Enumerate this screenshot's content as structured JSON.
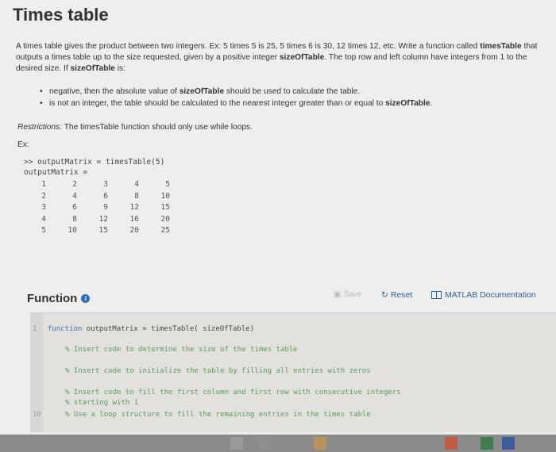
{
  "title": "Times table",
  "description": {
    "p1": "A times table gives the product between two integers. Ex: 5 times 5 is 25,  5 times 6 is 30, 12 times 12, etc. Write a function called ",
    "fname": "timesTable",
    "p2": " that outputs a times table up to the size requested, given by a positive integer ",
    "arg1": "sizeOfTable",
    "p3": ". The top row and left column have integers from 1 to the desired size. If ",
    "arg2": "sizeOfTable",
    "p4": " is:"
  },
  "bullets": [
    {
      "pre": "negative, then the absolute value of ",
      "bold": "sizeOfTable",
      "post": " should be used to calculate the table."
    },
    {
      "pre": "is not an integer, the table should be calculated to the nearest integer greater than or equal to ",
      "bold": "sizeOfTable",
      "post": "."
    }
  ],
  "restrictions": {
    "label": "Restrictions:",
    "text": " The timesTable function should only use while loops."
  },
  "example_label": "Ex:",
  "code_lines": [
    ">> outputMatrix = timesTable(5)",
    "outputMatrix ="
  ],
  "matrix": [
    [
      "1",
      "2",
      "3",
      "4",
      "5"
    ],
    [
      "2",
      "4",
      "6",
      "8",
      "10"
    ],
    [
      "3",
      "6",
      "9",
      "12",
      "15"
    ],
    [
      "4",
      "8",
      "12",
      "16",
      "20"
    ],
    [
      "5",
      "10",
      "15",
      "20",
      "25"
    ]
  ],
  "function_header": "Function",
  "buttons": {
    "save": "Save",
    "reset": "Reset",
    "docs": "MATLAB Documentation"
  },
  "editor": {
    "line_numbers": [
      "1",
      "10"
    ],
    "l1_kw": "function",
    "l1_rest": " outputMatrix = timesTable( sizeOfTable)",
    "c1": "% Insert code to determine the size of the times table",
    "c2": "% Insert code to initialize the table by filling all entries with zeros",
    "c3": "% Insert code to fill the first column and first row with consecutive integers",
    "c4": "% starting with 1",
    "c5": "% Use a loop structure to fill the remaining entries in the times table"
  },
  "colors": {
    "link": "#2f5f9a",
    "keyword": "#3b6fb5",
    "comment": "#5a9a5a"
  }
}
